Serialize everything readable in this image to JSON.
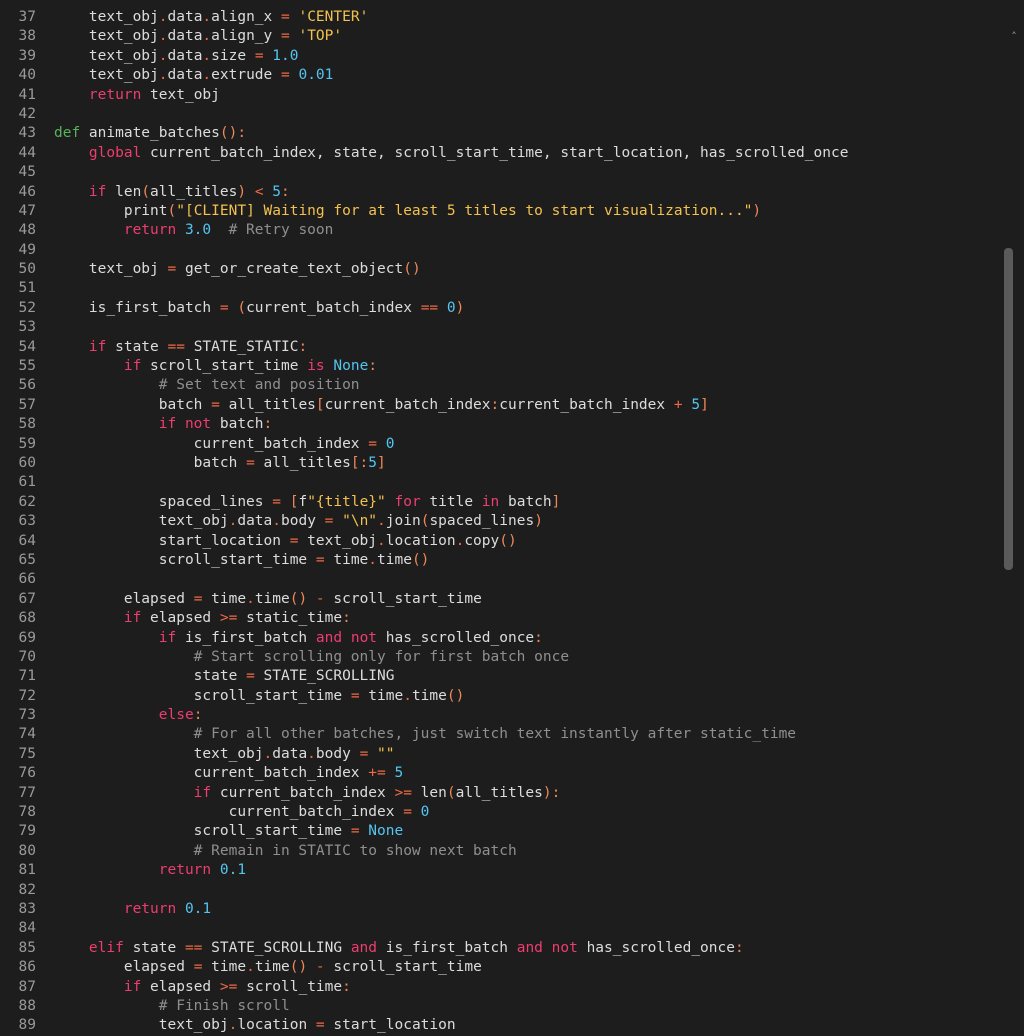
{
  "editor": {
    "lines": [
      {
        "n": "37",
        "t": [
          [
            "",
            "    text_obj"
          ],
          [
            "op",
            "."
          ],
          [
            "",
            "data"
          ],
          [
            "op",
            "."
          ],
          [
            "",
            "align_x "
          ],
          [
            "op",
            "="
          ],
          [
            "str",
            " 'CENTER'"
          ]
        ]
      },
      {
        "n": "38",
        "t": [
          [
            "",
            "    text_obj"
          ],
          [
            "op",
            "."
          ],
          [
            "",
            "data"
          ],
          [
            "op",
            "."
          ],
          [
            "",
            "align_y "
          ],
          [
            "op",
            "="
          ],
          [
            "str",
            " 'TOP'"
          ]
        ]
      },
      {
        "n": "39",
        "t": [
          [
            "",
            "    text_obj"
          ],
          [
            "op",
            "."
          ],
          [
            "",
            "data"
          ],
          [
            "op",
            "."
          ],
          [
            "",
            "size "
          ],
          [
            "op",
            "="
          ],
          [
            "num",
            " 1.0"
          ]
        ]
      },
      {
        "n": "40",
        "t": [
          [
            "",
            "    text_obj"
          ],
          [
            "op",
            "."
          ],
          [
            "",
            "data"
          ],
          [
            "op",
            "."
          ],
          [
            "",
            "extrude "
          ],
          [
            "op",
            "="
          ],
          [
            "num",
            " 0.01"
          ]
        ]
      },
      {
        "n": "41",
        "t": [
          [
            "kw",
            "    return"
          ],
          [
            "",
            " text_obj"
          ]
        ]
      },
      {
        "n": "42",
        "t": []
      },
      {
        "n": "43",
        "t": [
          [
            "df",
            "def"
          ],
          [
            "",
            " animate_batches"
          ],
          [
            "pn",
            "():"
          ]
        ]
      },
      {
        "n": "44",
        "t": [
          [
            "kw",
            "    global"
          ],
          [
            "",
            " current_batch_index, state, scroll_start_time, start_location, has_scrolled_once"
          ]
        ]
      },
      {
        "n": "45",
        "t": []
      },
      {
        "n": "46",
        "t": [
          [
            "kw",
            "    if"
          ],
          [
            "",
            " len"
          ],
          [
            "pn",
            "("
          ],
          [
            "",
            "all_titles"
          ],
          [
            "pn",
            ")"
          ],
          [
            "op",
            " <"
          ],
          [
            "num",
            " 5"
          ],
          [
            "pn",
            ":"
          ]
        ]
      },
      {
        "n": "47",
        "t": [
          [
            "",
            "        print"
          ],
          [
            "pn",
            "("
          ],
          [
            "str",
            "\"[CLIENT] Waiting for at least 5 titles to start visualization...\""
          ],
          [
            "pn",
            ")"
          ]
        ]
      },
      {
        "n": "48",
        "t": [
          [
            "kw",
            "        return"
          ],
          [
            "num",
            " 3.0"
          ],
          [
            "cm",
            "  # Retry soon"
          ]
        ]
      },
      {
        "n": "49",
        "t": []
      },
      {
        "n": "50",
        "t": [
          [
            "",
            "    text_obj "
          ],
          [
            "op",
            "="
          ],
          [
            "",
            " get_or_create_text_object"
          ],
          [
            "pn",
            "()"
          ]
        ]
      },
      {
        "n": "51",
        "t": []
      },
      {
        "n": "52",
        "t": [
          [
            "",
            "    is_first_batch "
          ],
          [
            "op",
            "="
          ],
          [
            "pn",
            " ("
          ],
          [
            "",
            "current_batch_index "
          ],
          [
            "op",
            "=="
          ],
          [
            "num",
            " 0"
          ],
          [
            "pn",
            ")"
          ]
        ]
      },
      {
        "n": "53",
        "t": []
      },
      {
        "n": "54",
        "t": [
          [
            "kw",
            "    if"
          ],
          [
            "",
            " state "
          ],
          [
            "op",
            "=="
          ],
          [
            "",
            " STATE_STATIC"
          ],
          [
            "pn",
            ":"
          ]
        ]
      },
      {
        "n": "55",
        "t": [
          [
            "kw",
            "        if"
          ],
          [
            "",
            " scroll_start_time "
          ],
          [
            "kw",
            "is"
          ],
          [
            "bi",
            " None"
          ],
          [
            "pn",
            ":"
          ]
        ]
      },
      {
        "n": "56",
        "t": [
          [
            "cm",
            "            # Set text and position"
          ]
        ]
      },
      {
        "n": "57",
        "t": [
          [
            "",
            "            batch "
          ],
          [
            "op",
            "="
          ],
          [
            "",
            " all_titles"
          ],
          [
            "pn",
            "["
          ],
          [
            "",
            "current_batch_index"
          ],
          [
            "pn",
            ":"
          ],
          [
            "",
            "current_batch_index "
          ],
          [
            "op",
            "+"
          ],
          [
            "num",
            " 5"
          ],
          [
            "pn",
            "]"
          ]
        ]
      },
      {
        "n": "58",
        "t": [
          [
            "kw",
            "            if"
          ],
          [
            "kw",
            " not"
          ],
          [
            "",
            " batch"
          ],
          [
            "pn",
            ":"
          ]
        ]
      },
      {
        "n": "59",
        "t": [
          [
            "",
            "                current_batch_index "
          ],
          [
            "op",
            "="
          ],
          [
            "num",
            " 0"
          ]
        ]
      },
      {
        "n": "60",
        "t": [
          [
            "",
            "                batch "
          ],
          [
            "op",
            "="
          ],
          [
            "",
            " all_titles"
          ],
          [
            "pn",
            "[:"
          ],
          [
            "num",
            "5"
          ],
          [
            "pn",
            "]"
          ]
        ]
      },
      {
        "n": "61",
        "t": []
      },
      {
        "n": "62",
        "t": [
          [
            "",
            "            spaced_lines "
          ],
          [
            "op",
            "="
          ],
          [
            "pn",
            " ["
          ],
          [
            "",
            "f"
          ],
          [
            "str",
            "\"{title}\""
          ],
          [
            "kw",
            " for"
          ],
          [
            "",
            " title "
          ],
          [
            "kw",
            "in"
          ],
          [
            "",
            " batch"
          ],
          [
            "pn",
            "]"
          ]
        ]
      },
      {
        "n": "63",
        "t": [
          [
            "",
            "            text_obj"
          ],
          [
            "op",
            "."
          ],
          [
            "",
            "data"
          ],
          [
            "op",
            "."
          ],
          [
            "",
            "body "
          ],
          [
            "op",
            "="
          ],
          [
            "str",
            " \"\\n\""
          ],
          [
            "op",
            "."
          ],
          [
            "",
            "join"
          ],
          [
            "pn",
            "("
          ],
          [
            "",
            "spaced_lines"
          ],
          [
            "pn",
            ")"
          ]
        ]
      },
      {
        "n": "64",
        "t": [
          [
            "",
            "            start_location "
          ],
          [
            "op",
            "="
          ],
          [
            "",
            " text_obj"
          ],
          [
            "op",
            "."
          ],
          [
            "",
            "location"
          ],
          [
            "op",
            "."
          ],
          [
            "",
            "copy"
          ],
          [
            "pn",
            "()"
          ]
        ]
      },
      {
        "n": "65",
        "t": [
          [
            "",
            "            scroll_start_time "
          ],
          [
            "op",
            "="
          ],
          [
            "",
            " time"
          ],
          [
            "op",
            "."
          ],
          [
            "",
            "time"
          ],
          [
            "pn",
            "()"
          ]
        ]
      },
      {
        "n": "66",
        "t": []
      },
      {
        "n": "67",
        "t": [
          [
            "",
            "        elapsed "
          ],
          [
            "op",
            "="
          ],
          [
            "",
            " time"
          ],
          [
            "op",
            "."
          ],
          [
            "",
            "time"
          ],
          [
            "pn",
            "()"
          ],
          [
            "op",
            " -"
          ],
          [
            "",
            " scroll_start_time"
          ]
        ]
      },
      {
        "n": "68",
        "t": [
          [
            "kw",
            "        if"
          ],
          [
            "",
            " elapsed "
          ],
          [
            "op",
            ">="
          ],
          [
            "",
            " static_time"
          ],
          [
            "pn",
            ":"
          ]
        ]
      },
      {
        "n": "69",
        "t": [
          [
            "kw",
            "            if"
          ],
          [
            "",
            " is_first_batch "
          ],
          [
            "kw",
            "and"
          ],
          [
            "kw",
            " not"
          ],
          [
            "",
            " has_scrolled_once"
          ],
          [
            "pn",
            ":"
          ]
        ]
      },
      {
        "n": "70",
        "t": [
          [
            "cm",
            "                # Start scrolling only for first batch once"
          ]
        ]
      },
      {
        "n": "71",
        "t": [
          [
            "",
            "                state "
          ],
          [
            "op",
            "="
          ],
          [
            "",
            " STATE_SCROLLING"
          ]
        ]
      },
      {
        "n": "72",
        "t": [
          [
            "",
            "                scroll_start_time "
          ],
          [
            "op",
            "="
          ],
          [
            "",
            " time"
          ],
          [
            "op",
            "."
          ],
          [
            "",
            "time"
          ],
          [
            "pn",
            "()"
          ]
        ]
      },
      {
        "n": "73",
        "t": [
          [
            "kw",
            "            else"
          ],
          [
            "pn",
            ":"
          ]
        ]
      },
      {
        "n": "74",
        "t": [
          [
            "cm",
            "                # For all other batches, just switch text instantly after static_time"
          ]
        ]
      },
      {
        "n": "75",
        "t": [
          [
            "",
            "                text_obj"
          ],
          [
            "op",
            "."
          ],
          [
            "",
            "data"
          ],
          [
            "op",
            "."
          ],
          [
            "",
            "body "
          ],
          [
            "op",
            "="
          ],
          [
            "str",
            " \"\""
          ]
        ]
      },
      {
        "n": "76",
        "t": [
          [
            "",
            "                current_batch_index "
          ],
          [
            "op",
            "+="
          ],
          [
            "num",
            " 5"
          ]
        ]
      },
      {
        "n": "77",
        "t": [
          [
            "kw",
            "                if"
          ],
          [
            "",
            " current_batch_index "
          ],
          [
            "op",
            ">="
          ],
          [
            "",
            " len"
          ],
          [
            "pn",
            "("
          ],
          [
            "",
            "all_titles"
          ],
          [
            "pn",
            "):"
          ]
        ]
      },
      {
        "n": "78",
        "t": [
          [
            "",
            "                    current_batch_index "
          ],
          [
            "op",
            "="
          ],
          [
            "num",
            " 0"
          ]
        ]
      },
      {
        "n": "79",
        "t": [
          [
            "",
            "                scroll_start_time "
          ],
          [
            "op",
            "="
          ],
          [
            "bi",
            " None"
          ]
        ]
      },
      {
        "n": "80",
        "t": [
          [
            "cm",
            "                # Remain in STATIC to show next batch"
          ]
        ]
      },
      {
        "n": "81",
        "t": [
          [
            "kw",
            "            return"
          ],
          [
            "num",
            " 0.1"
          ]
        ]
      },
      {
        "n": "82",
        "t": []
      },
      {
        "n": "83",
        "t": [
          [
            "kw",
            "        return"
          ],
          [
            "num",
            " 0.1"
          ]
        ]
      },
      {
        "n": "84",
        "t": []
      },
      {
        "n": "85",
        "t": [
          [
            "kw",
            "    elif"
          ],
          [
            "",
            " state "
          ],
          [
            "op",
            "=="
          ],
          [
            "",
            " STATE_SCROLLING "
          ],
          [
            "kw",
            "and"
          ],
          [
            "",
            " is_first_batch "
          ],
          [
            "kw",
            "and"
          ],
          [
            "kw",
            " not"
          ],
          [
            "",
            " has_scrolled_once"
          ],
          [
            "pn",
            ":"
          ]
        ]
      },
      {
        "n": "86",
        "t": [
          [
            "",
            "        elapsed "
          ],
          [
            "op",
            "="
          ],
          [
            "",
            " time"
          ],
          [
            "op",
            "."
          ],
          [
            "",
            "time"
          ],
          [
            "pn",
            "()"
          ],
          [
            "op",
            " -"
          ],
          [
            "",
            " scroll_start_time"
          ]
        ]
      },
      {
        "n": "87",
        "t": [
          [
            "kw",
            "        if"
          ],
          [
            "",
            " elapsed "
          ],
          [
            "op",
            ">="
          ],
          [
            "",
            " scroll_time"
          ],
          [
            "pn",
            ":"
          ]
        ]
      },
      {
        "n": "88",
        "t": [
          [
            "cm",
            "            # Finish scroll"
          ]
        ]
      },
      {
        "n": "89",
        "t": [
          [
            "",
            "            text_obj"
          ],
          [
            "op",
            "."
          ],
          [
            "",
            "location "
          ],
          [
            "op",
            "="
          ],
          [
            "",
            " start_location"
          ]
        ]
      }
    ]
  },
  "scrollbar": {
    "arrow_icon": "chevron-up-icon",
    "thumb_color": "#5a5a5a"
  },
  "colors": {
    "background": "#1d1d1d",
    "keyword": "#ee3d6f",
    "def": "#56b35a",
    "string": "#f2c14e",
    "number": "#54c5f0",
    "operator": "#ef6a45",
    "comment": "#8f8f8f"
  }
}
